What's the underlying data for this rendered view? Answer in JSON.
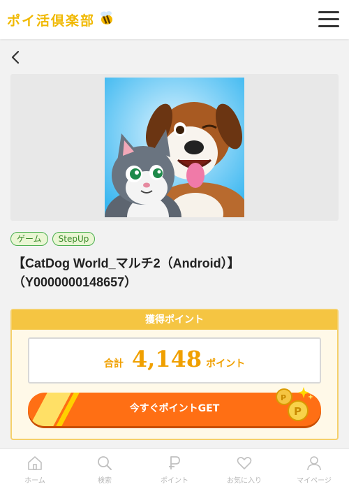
{
  "header": {
    "logo_text": "ポイ活倶楽部",
    "logo_icon": "bee-icon",
    "menu_icon": "hamburger-menu-icon"
  },
  "main": {
    "back_icon": "chevron-left-icon",
    "tags": [
      "ゲーム",
      "StepUp"
    ],
    "title": "【CatDog World_マルチ2（Android）】（Y0000000148657）"
  },
  "points": {
    "header": "獲得ポイント",
    "total_label": "合計",
    "value": "4,148",
    "unit": "ポイント",
    "cta_label": "今すぐポイントGET"
  },
  "bottom_nav": {
    "items": [
      {
        "label": "ホーム",
        "icon": "home-icon"
      },
      {
        "label": "検索",
        "icon": "search-icon"
      },
      {
        "label": "ポイント",
        "icon": "point-icon"
      },
      {
        "label": "お気に入り",
        "icon": "heart-icon"
      },
      {
        "label": "マイページ",
        "icon": "user-icon"
      }
    ]
  },
  "colors": {
    "accent": "#f5c542",
    "cta": "#ff6f14",
    "point_text": "#f0a000",
    "tag_border": "#4caf50"
  }
}
